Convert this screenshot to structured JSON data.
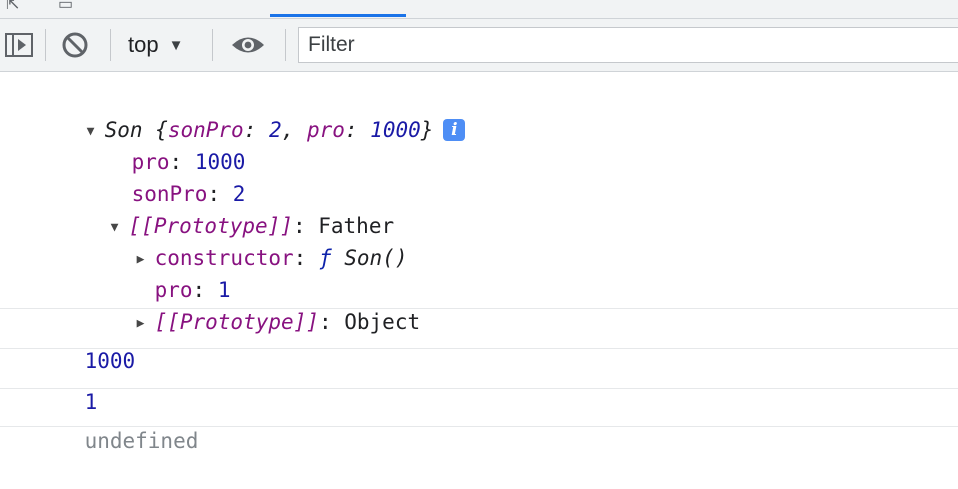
{
  "toolbar": {
    "context": "top",
    "filter_placeholder": "Filter"
  },
  "icons": {
    "sidebar": "sidebar-toggle-icon",
    "clear": "clear-console-icon",
    "eye": "eye-icon",
    "context_arrow": "caret-down-icon"
  },
  "console": {
    "object": {
      "class_name": "Son",
      "preview_open": "{",
      "preview_key1": "sonPro",
      "preview_val1": "2",
      "preview_key2": "pro",
      "preview_val2": "1000",
      "preview_close": "}",
      "info": "i",
      "props": [
        {
          "key": "pro",
          "value": "1000"
        },
        {
          "key": "sonPro",
          "value": "2"
        }
      ],
      "prototype": {
        "label": "[[Prototype]]",
        "value": "Father",
        "constructor_key": "constructor",
        "constructor_f": "ƒ",
        "constructor_val": "Son()",
        "pro_key": "pro",
        "pro_value": "1",
        "inner_label": "[[Prototype]]",
        "inner_value": "Object"
      }
    },
    "outputs": [
      "1000",
      "1",
      "undefined"
    ]
  },
  "colors": {
    "key": "#881280",
    "number": "#1a1aa6",
    "muted": "#80868b",
    "info_badge": "#4e8ef5",
    "tab_accent": "#1a73e8"
  }
}
